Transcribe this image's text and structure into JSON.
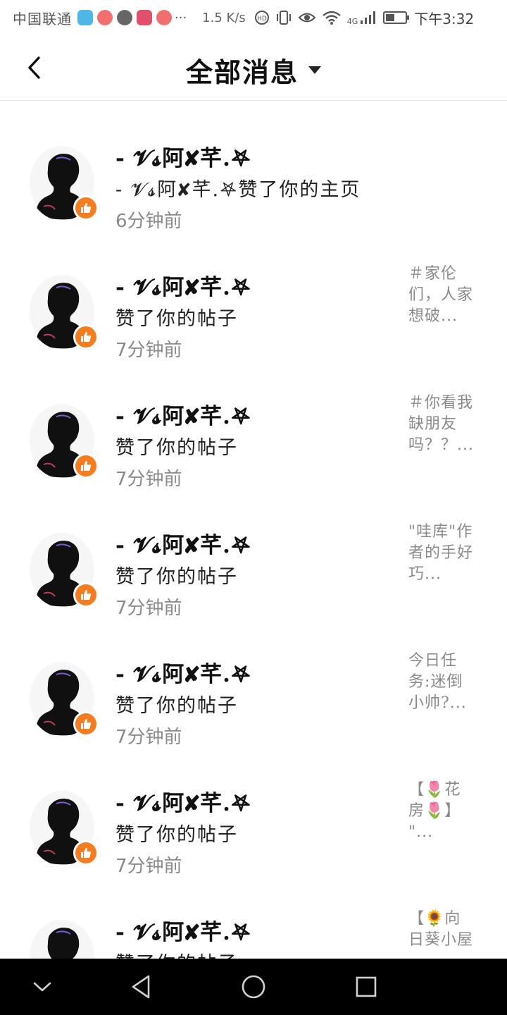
{
  "status_bar": {
    "carrier": "中国联通",
    "more": "···",
    "net_speed": "1.5 K/s",
    "network_type": "4G",
    "time": "下午3:32",
    "notification_icons": [
      "shield-icon",
      "app-icon",
      "chat-icon",
      "video-icon",
      "app-icon"
    ],
    "system_icons": [
      "hd-icon",
      "vibrate-icon",
      "eye-icon",
      "wifi-icon",
      "signal-icon",
      "battery-icon"
    ]
  },
  "header": {
    "title": "全部消息",
    "back_icon": "back-chevron-icon",
    "dropdown_icon": "caret-down-icon"
  },
  "notifications": [
    {
      "name": "- 𝓥𝓼阿✘芊.𖤐",
      "action": "- 𝓥𝓼阿✘芊.𖤐赞了你的主页",
      "time": "6分钟前",
      "preview": ""
    },
    {
      "name": "- 𝓥𝓼阿✘芊.𖤐",
      "action": "赞了你的帖子",
      "time": "7分钟前",
      "preview": "＃家伦\n们，人家\n想破..."
    },
    {
      "name": "- 𝓥𝓼阿✘芊.𖤐",
      "action": "赞了你的帖子",
      "time": "7分钟前",
      "preview": "＃你看我\n缺朋友\n吗？？..."
    },
    {
      "name": "- 𝓥𝓼阿✘芊.𖤐",
      "action": "赞了你的帖子",
      "time": "7分钟前",
      "preview": "\"哇库\"作\n者的手好\n巧..."
    },
    {
      "name": "- 𝓥𝓼阿✘芊.𖤐",
      "action": "赞了你的帖子",
      "time": "7分钟前",
      "preview": "今日任\n务:迷倒\n小帅?..."
    },
    {
      "name": "- 𝓥𝓼阿✘芊.𖤐",
      "action": "赞了你的帖子",
      "time": "7分钟前",
      "preview": "【🌷花\n房🌷】\n\"..."
    },
    {
      "name": "- 𝓥𝓼阿✘芊.𖤐",
      "action": "赞了你的帖子",
      "time": "",
      "preview": "【🌻向\n日葵小屋"
    }
  ],
  "colors": {
    "like_badge": "#f57c1f",
    "time_text": "#8a8a8a",
    "nav_bar": "#000000"
  },
  "nav_bar": {
    "buttons": [
      "collapse-chevron-icon",
      "back-triangle-icon",
      "home-circle-icon",
      "recents-square-icon"
    ]
  }
}
